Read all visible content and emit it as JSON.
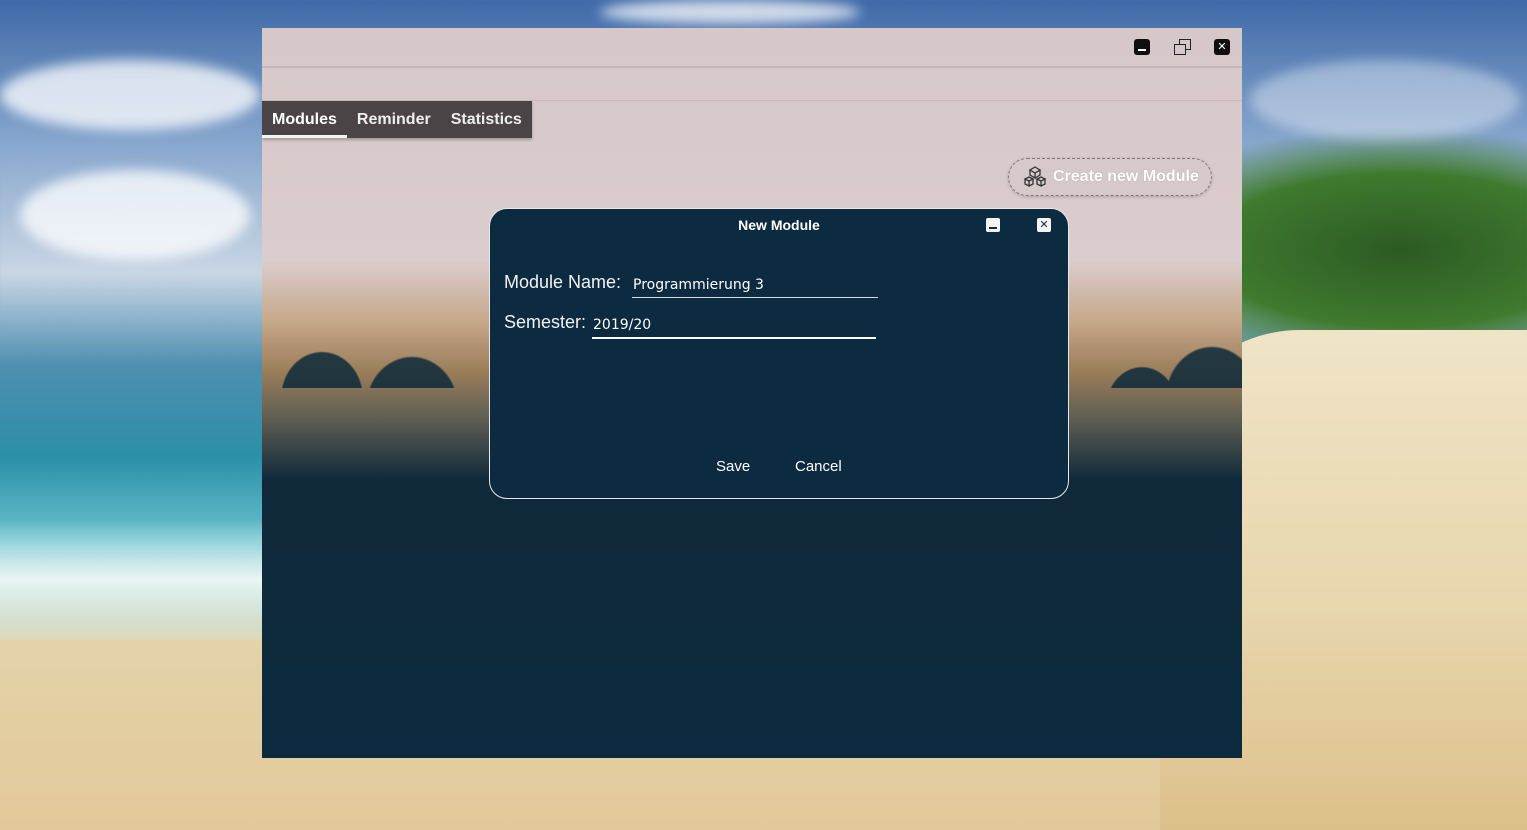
{
  "app": {
    "tabs": [
      {
        "label": "Modules",
        "active": true
      },
      {
        "label": "Reminder",
        "active": false
      },
      {
        "label": "Statistics",
        "active": false
      }
    ],
    "create_button_label": "Create new Module",
    "window_controls": [
      "minimize-icon",
      "restore-icon",
      "close-icon"
    ]
  },
  "dialog": {
    "title": "New Module",
    "module_name_label": "Module Name:",
    "module_name_value": "Programmierung 3",
    "semester_label": "Semester:",
    "semester_value": "2019/20",
    "save_label": "Save",
    "cancel_label": "Cancel",
    "controls": [
      "minimize-icon",
      "close-icon"
    ]
  },
  "colors": {
    "dialog_bg": "#0c2a40",
    "tab_bar_bg": "#4a4446",
    "window_bg_top": "#d6c7c9"
  }
}
